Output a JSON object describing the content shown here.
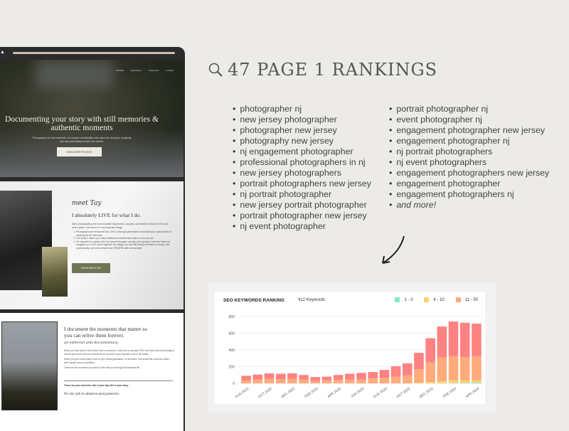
{
  "website": {
    "nav": [
      "Portfolio",
      "Experience",
      "Investment",
      "Contact"
    ],
    "hero_title": "Documenting your story with still memories & authentic moments",
    "hero_subtitle": "Photography for real moments, for couples and families who value the beauty in simplicity and raw authenticity in their love stories.",
    "hero_button": "VIEW MORE PHOTOS",
    "about_script": "meet Tay",
    "about_heading": "I absolutely LIVE for what I do.",
    "about_intro": "After photographing the most beautiful elopements, couples, and families full time for the last seven years, I've learned 3 very important things:",
    "about_points": [
      "Photographs are heirlooms that LIVE on through generations and develops a special kind of meaning for the beholder.",
      "Our story is made up a million different moments that make us who we are.",
      "It's important to capture all of the above because one day we're going to miss the times we snuggled up on the couch together, the laughs we had with family members no longer with us physically, and the moments we CREATED with one another."
    ],
    "about_button": "MORE ABOUT ME",
    "doc_heading": "I document the moments that matter so you can relive them forever.",
    "doc_script": "an editorial anti-documentary",
    "doc_paragraphs": [
      "When you look back to the photos from our session, I want you to actually FEEL how their arms felt entangled around yours and how you embraced one another in your favorite room in the house.",
      "When you pull out the baby book on your oldest graduation, to remember how small their precious hands were beside yours is priceless.",
      "These are the moments you need to take with you through this beautiful life."
    ],
    "doc_bold": "These are your moments, this is your day, this is your story.",
    "doc_closing": "It's my job to observe and preserve."
  },
  "headline": {
    "icon": "magnifier-icon",
    "text": "47 PAGE 1 RANKINGS"
  },
  "keywords_col1": [
    "photographer nj",
    "new jersey photographer",
    "photographer new jersey",
    "photography new jersey",
    "nj engagement photographer",
    "professional photographers in nj",
    "new jersey photographers",
    "portrait photographers new jersey",
    "nj portrait photographer",
    "new jersey portrait photographer",
    "portrait photographer new jersey",
    "nj event photographer"
  ],
  "keywords_col2": [
    "portrait photographer nj",
    "event photographer nj",
    "engagement photographer new jersey",
    "engagement photographer nj",
    "nj portrait photographers",
    "nj event photographers",
    "engagement photographers new jersey",
    "engagement photographer",
    "engagement photographers nj",
    "and more!"
  ],
  "chart_data": {
    "type": "bar",
    "stacked": true,
    "title": "SEO KEYWORDS RANKING",
    "subtitle": "412 Keywords",
    "legend_position": "top-right",
    "grid": true,
    "ylim": [
      0,
      800
    ],
    "yticks": [
      0,
      200,
      400,
      600,
      800
    ],
    "categories": [
      "AUG 2022",
      "SEP 2022",
      "OCT 2022",
      "NOV 2022",
      "DEC 2022",
      "JAN 2023",
      "FEB 2023",
      "MAR 2023",
      "APR 2023",
      "MAY 2023",
      "JUN 2023",
      "JUL 2023",
      "AUG 2023",
      "SEP 2023",
      "OCT 2023",
      "NOV 2023",
      "DEC 2023",
      "JAN 2024",
      "FEB 2024",
      "MAR 2024",
      "APR 2024"
    ],
    "xtick_labels": [
      "AUG 2022",
      "OCT 2022",
      "DEC 2022",
      "FEB 2023",
      "APR 2023",
      "JUN 2023",
      "AUG 2023",
      "OCT 2023",
      "DEC 2023",
      "FEB 2024",
      "APR 2024"
    ],
    "series": [
      {
        "name": "1 - 3",
        "color": "#86e8bf",
        "values": [
          0,
          0,
          0,
          0,
          0,
          0,
          0,
          0,
          0,
          0,
          0,
          0,
          0,
          0,
          0,
          0,
          0,
          2,
          5,
          5,
          10
        ]
      },
      {
        "name": "4 - 10",
        "color": "#fbd36d",
        "values": [
          0,
          0,
          0,
          0,
          0,
          0,
          0,
          0,
          0,
          0,
          0,
          0,
          0,
          0,
          0,
          8,
          15,
          23,
          30,
          30,
          25
        ]
      },
      {
        "name": "11 - 50",
        "color": "#ffab7c",
        "values": [
          35,
          45,
          55,
          50,
          55,
          45,
          30,
          35,
          40,
          45,
          45,
          60,
          65,
          80,
          95,
          160,
          235,
          285,
          290,
          280,
          290
        ]
      },
      {
        "color": "#ff8282",
        "values": [
          55,
          60,
          65,
          65,
          65,
          55,
          45,
          45,
          60,
          70,
          80,
          75,
          95,
          125,
          145,
          197,
          290,
          370,
          415,
          410,
          390
        ]
      }
    ]
  }
}
